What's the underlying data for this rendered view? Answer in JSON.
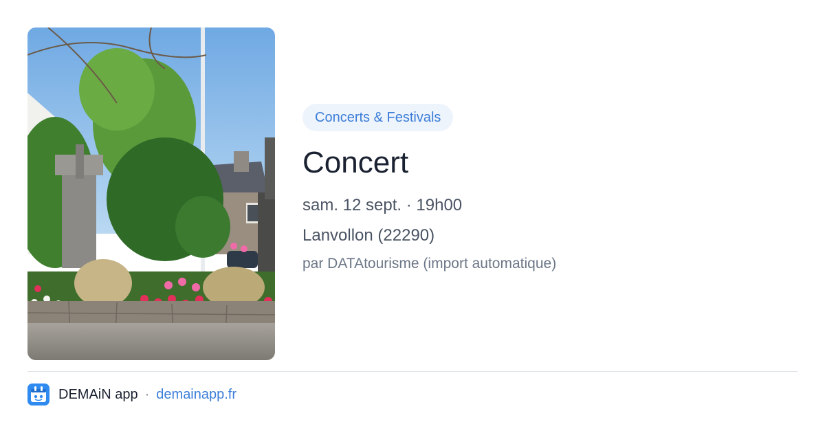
{
  "event": {
    "category": "Concerts & Festivals",
    "title": "Concert",
    "datetime": "sam. 12 sept. · 19h00",
    "location": "Lanvollon (22290)",
    "source": "par DATAtourisme (import automatique)"
  },
  "footer": {
    "app_name": "DEMAiN app",
    "separator": "·",
    "link": "demainapp.fr"
  },
  "colors": {
    "accent": "#3b7dd8",
    "chip_bg": "#eef4fc",
    "title": "#1a2130",
    "muted": "#6b7686"
  },
  "icons": {
    "app": "demain-app-icon"
  }
}
